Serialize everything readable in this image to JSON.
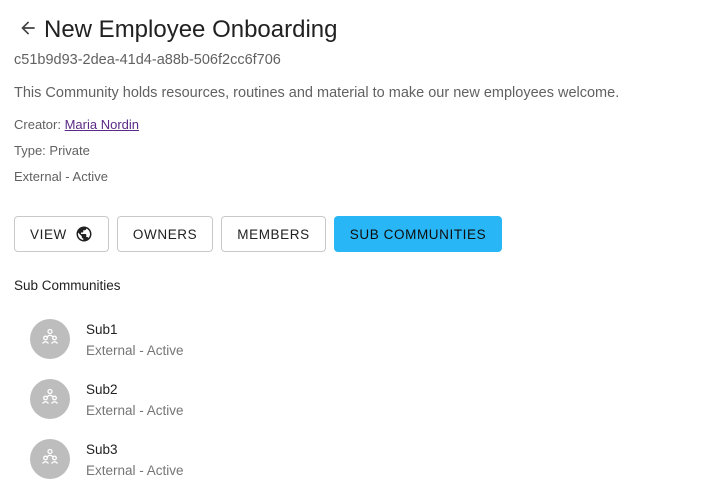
{
  "header": {
    "back_icon": "arrow-left-icon",
    "title": "New Employee Onboarding"
  },
  "community": {
    "id": "c51b9d93-2dea-41d4-a88b-506f2cc6f706",
    "description": "This Community holds resources, routines and material to make our new employees welcome.",
    "creator_label": "Creator:",
    "creator_name": "Maria Nordin",
    "type_text": "Type: Private",
    "status_text": "External - Active"
  },
  "tabs": [
    {
      "label": "VIEW",
      "icon": "globe-icon",
      "active": false
    },
    {
      "label": "OWNERS",
      "active": false
    },
    {
      "label": "MEMBERS",
      "active": false
    },
    {
      "label": "SUB COMMUNITIES",
      "active": true
    }
  ],
  "sub_communities": {
    "title": "Sub Communities",
    "items": [
      {
        "name": "Sub1",
        "status": "External - Active",
        "icon": "group-icon"
      },
      {
        "name": "Sub2",
        "status": "External - Active",
        "icon": "group-icon"
      },
      {
        "name": "Sub3",
        "status": "External - Active",
        "icon": "group-icon"
      }
    ]
  },
  "colors": {
    "accent": "#29b6f6",
    "link": "#5b2a86",
    "avatar_bg": "#bdbdbd"
  }
}
